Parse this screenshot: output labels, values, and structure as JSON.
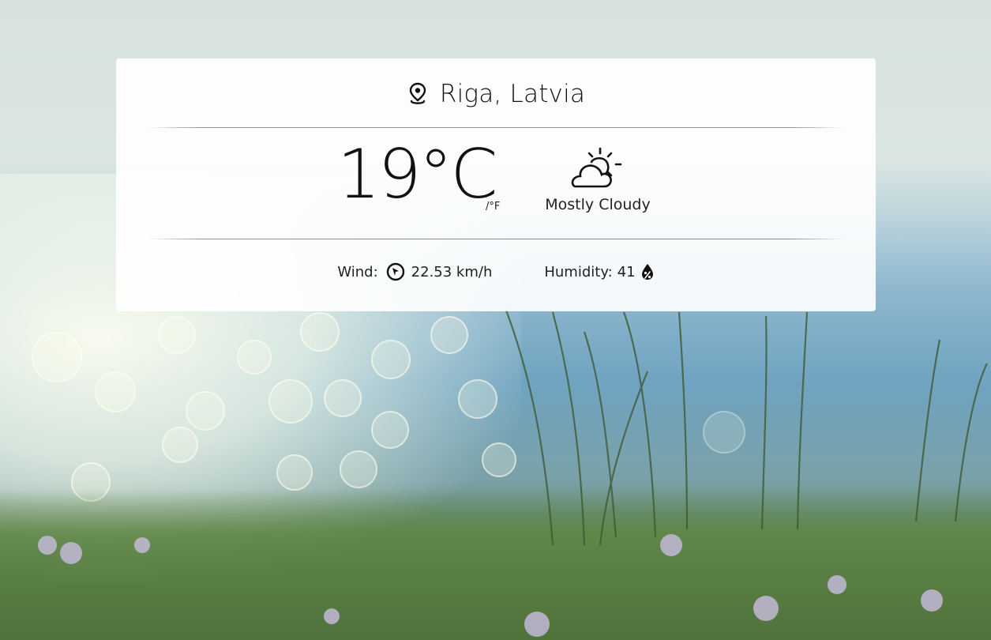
{
  "location": {
    "city": "Riga, Latvia",
    "icon": "map-pin-icon"
  },
  "current": {
    "temperature": "19°C",
    "unit_toggle": "/°F",
    "condition": "Mostly Cloudy",
    "condition_icon": "partly-cloudy-icon"
  },
  "details": {
    "wind_label": "Wind:",
    "wind_value": "22.53 km/h",
    "wind_icon": "compass-icon",
    "humidity_label": "Humidity:",
    "humidity_value": "41",
    "humidity_icon": "humidity-drop-icon"
  }
}
